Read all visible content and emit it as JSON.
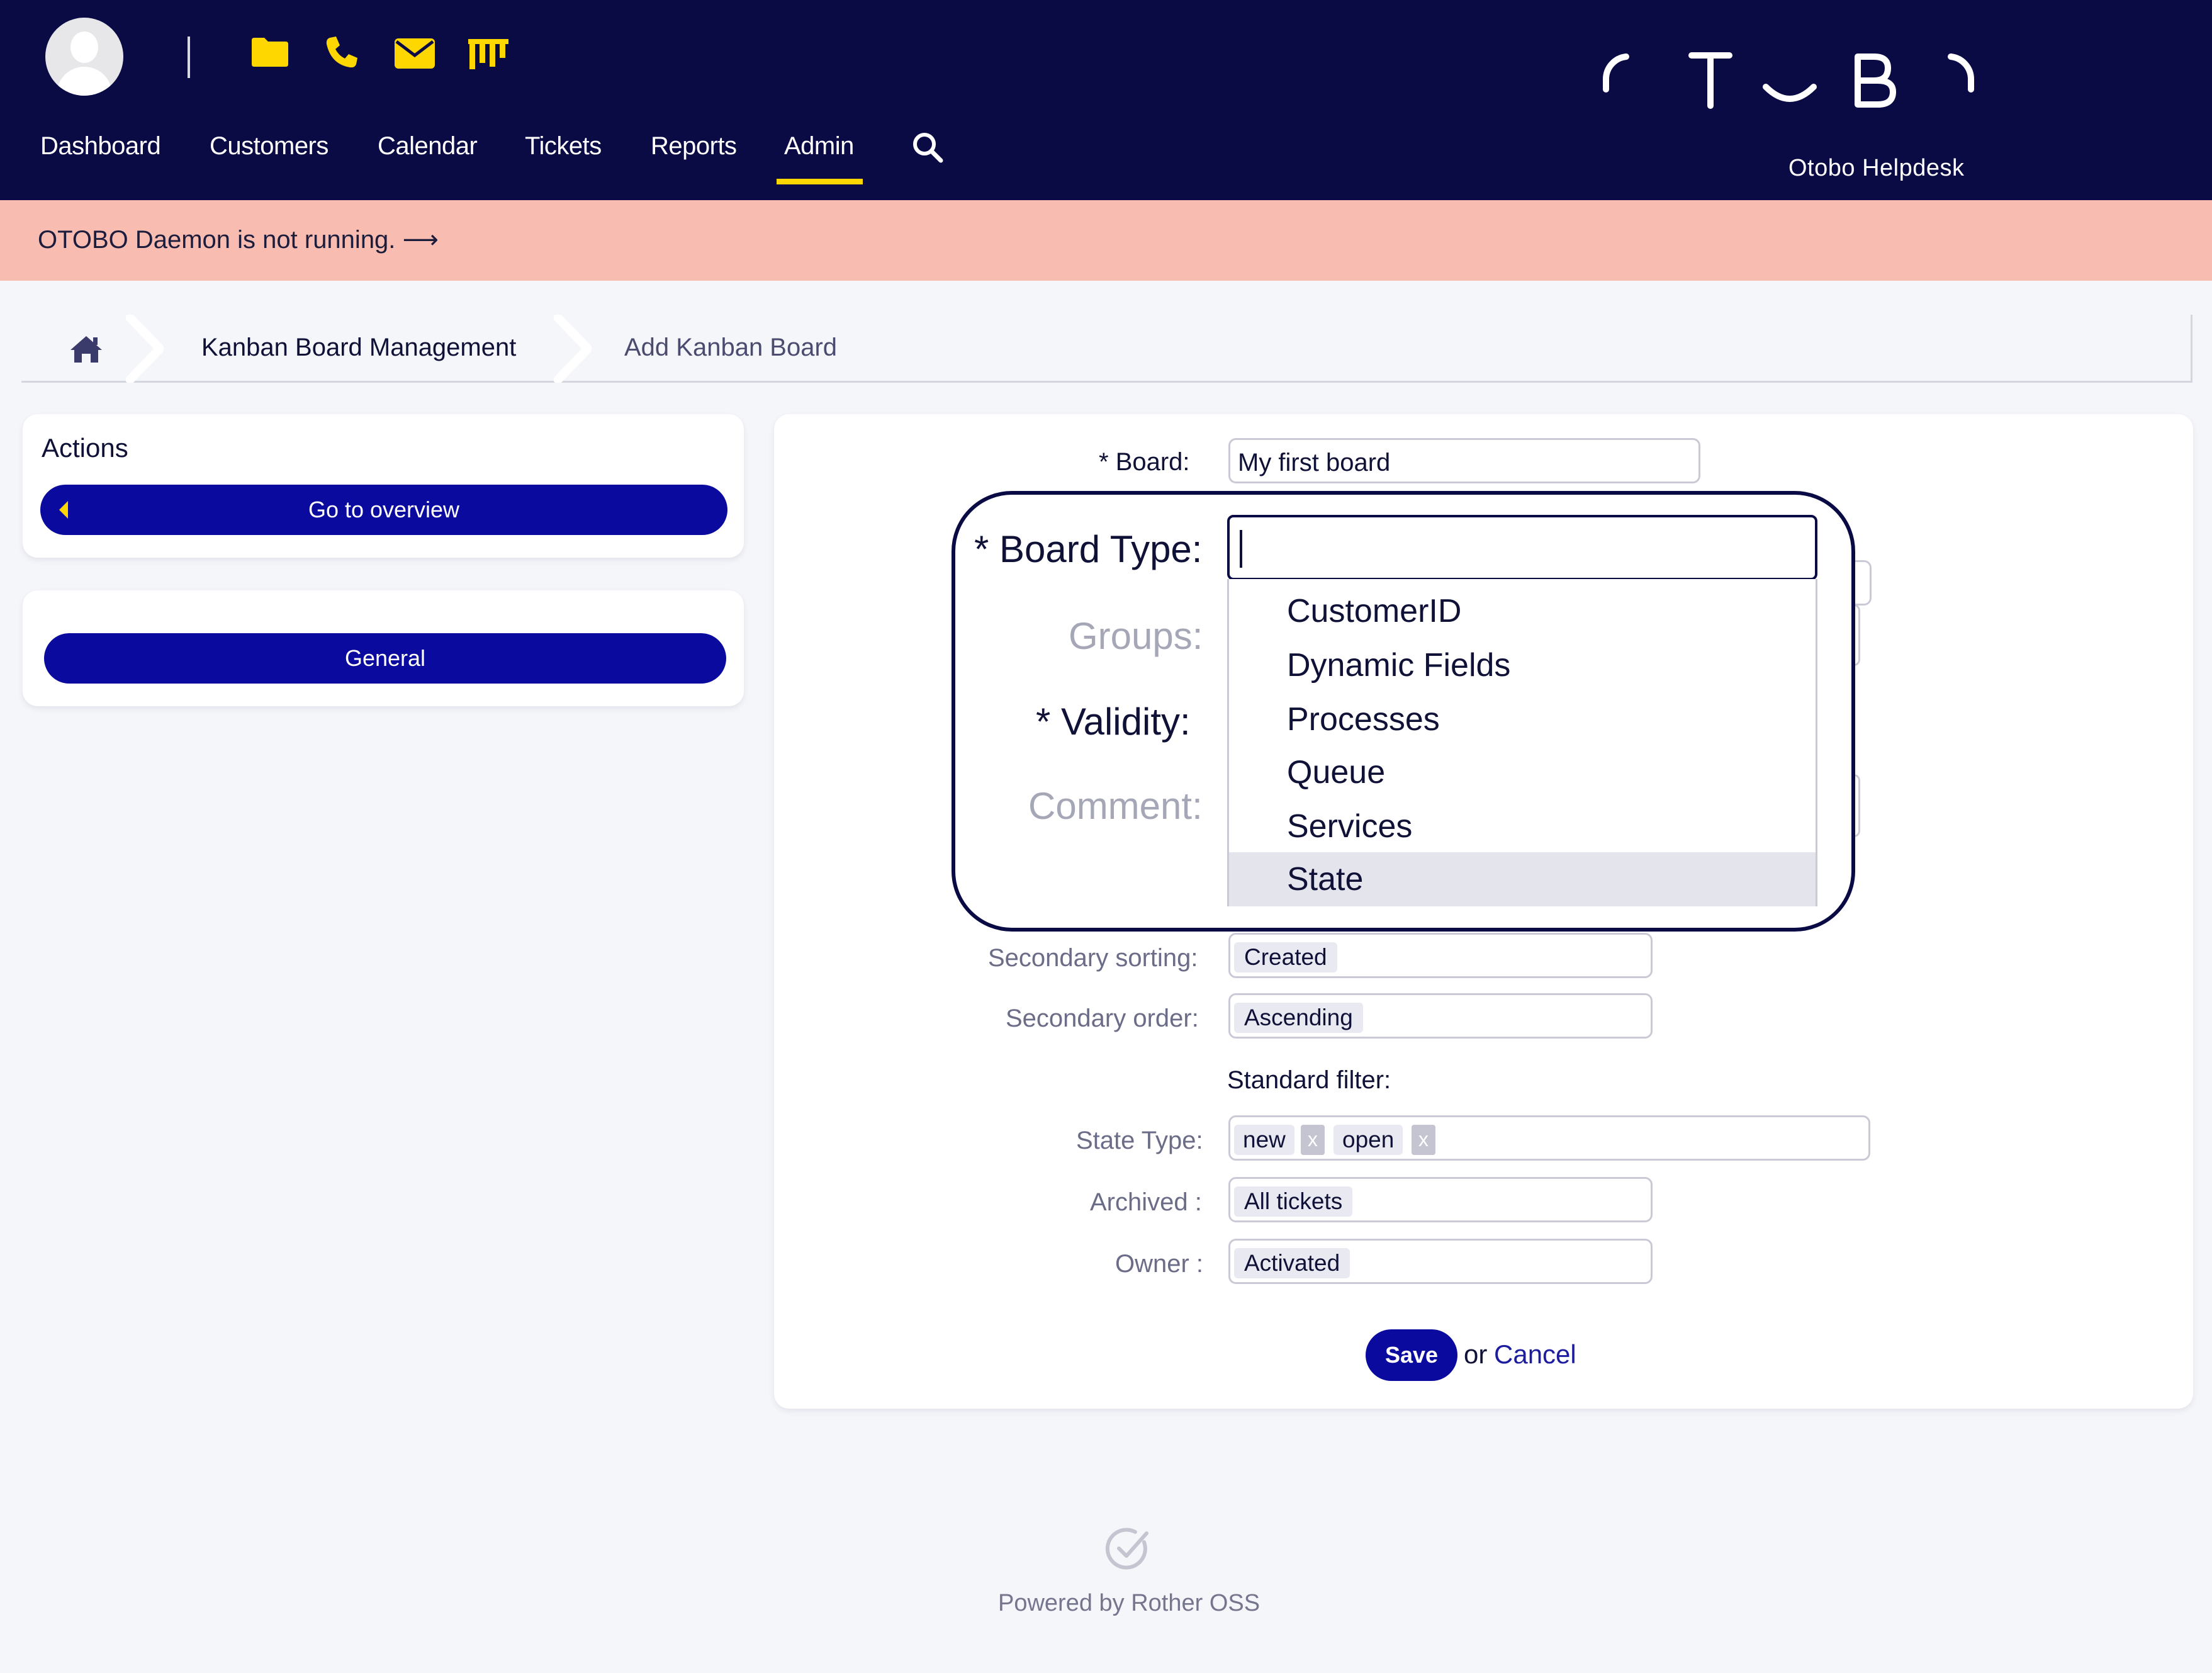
{
  "header": {
    "brand": "Otobo Helpdesk",
    "nav": [
      "Dashboard",
      "Customers",
      "Calendar",
      "Tickets",
      "Reports",
      "Admin"
    ],
    "active_nav": "Admin",
    "quick_icons": [
      "folder-icon",
      "phone-icon",
      "mail-icon",
      "kanban-icon"
    ]
  },
  "notice": {
    "text": "OTOBO Daemon is not running. ⟶"
  },
  "breadcrumb": {
    "items": [
      "Kanban Board Management",
      "Add Kanban Board"
    ]
  },
  "sidebar": {
    "actions_title": "Actions",
    "go_to_overview": "Go to overview",
    "general": "General"
  },
  "form": {
    "board_label": "Board:",
    "board_value": "My first board",
    "secondary_sorting_label": "Secondary sorting:",
    "secondary_sorting_value": "Created",
    "secondary_order_label": "Secondary order:",
    "secondary_order_value": "Ascending",
    "standard_filter_label": "Standard filter:",
    "state_type_label": "State Type:",
    "state_type_values": [
      "new",
      "open"
    ],
    "archived_label": "Archived :",
    "archived_value": "All tickets",
    "owner_label": "Owner :",
    "owner_value": "Activated",
    "save": "Save",
    "or": "or",
    "cancel": "Cancel"
  },
  "zoom": {
    "board_type_label": "Board Type:",
    "groups_label": "Groups:",
    "validity_label": "Validity:",
    "comment_label": "Comment:",
    "options": [
      "CustomerID",
      "Dynamic Fields",
      "Processes",
      "Queue",
      "Services",
      "State"
    ],
    "highlighted": "State"
  },
  "footer": {
    "text": "Powered by Rother OSS"
  },
  "colors": {
    "header_bg": "#0a0b45",
    "accent_yellow": "#ffd700",
    "notice_bg": "#f8bcb1",
    "button_blue": "#0a0b9e"
  }
}
